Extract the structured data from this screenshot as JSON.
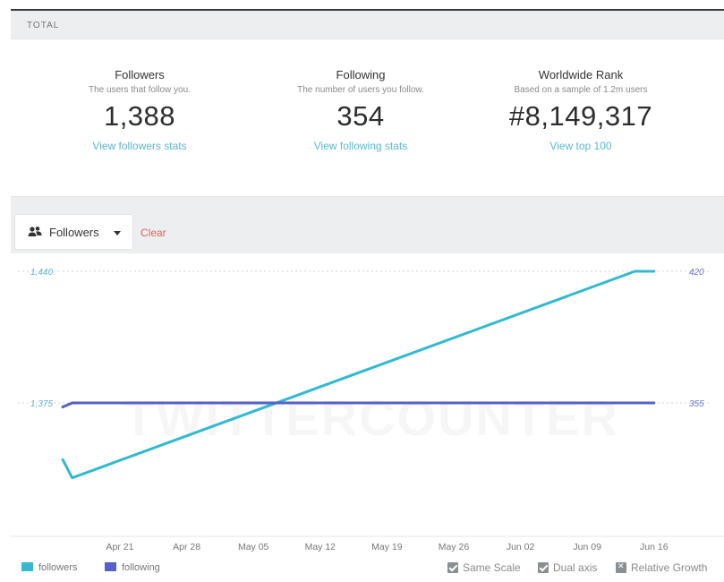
{
  "section": {
    "title": "TOTAL"
  },
  "stats": [
    {
      "title": "Followers",
      "subtitle": "The users that follow you.",
      "value": "1,388",
      "link": "View followers stats"
    },
    {
      "title": "Following",
      "subtitle": "The number of users you follow.",
      "value": "354",
      "link": "View following stats"
    },
    {
      "title": "Worldwide Rank",
      "subtitle": "Based on a sample of 1.2m users",
      "value": "#8,149,317",
      "link": "View top 100"
    }
  ],
  "toolbar": {
    "selector_label": "Followers",
    "clear_label": "Clear"
  },
  "watermark": "TWITTERCOUNTER",
  "chart_data": {
    "type": "line",
    "x_ticks": [
      "Apr 21",
      "Apr 28",
      "May 05",
      "May 12",
      "May 19",
      "May 26",
      "Jun 02",
      "Jun 09",
      "Jun 16"
    ],
    "left_axis": {
      "ticks": [
        1375,
        1440
      ],
      "tick_labels": [
        "1,375",
        "1,440"
      ]
    },
    "right_axis": {
      "ticks": [
        355,
        420
      ],
      "tick_labels": [
        "355",
        "420"
      ]
    },
    "series": [
      {
        "name": "followers",
        "axis": "left",
        "color": "#33b9cf",
        "x": [
          "Apr 15",
          "Apr 16",
          "Jun 14",
          "Jun 16"
        ],
        "y": [
          1347,
          1338,
          1440,
          1440
        ]
      },
      {
        "name": "following",
        "axis": "right",
        "color": "#5560c8",
        "x": [
          "Apr 15",
          "Apr 16",
          "Jun 16"
        ],
        "y": [
          353,
          355,
          355
        ]
      }
    ],
    "grid": "horizontal dotted at labelled ticks"
  },
  "legend": [
    {
      "label": "followers",
      "color": "#33b9cf"
    },
    {
      "label": "following",
      "color": "#5560c8"
    }
  ],
  "options": [
    {
      "label": "Same Scale",
      "checked": true
    },
    {
      "label": "Dual axis",
      "checked": true
    },
    {
      "label": "Relative Growth",
      "checked": false
    }
  ]
}
